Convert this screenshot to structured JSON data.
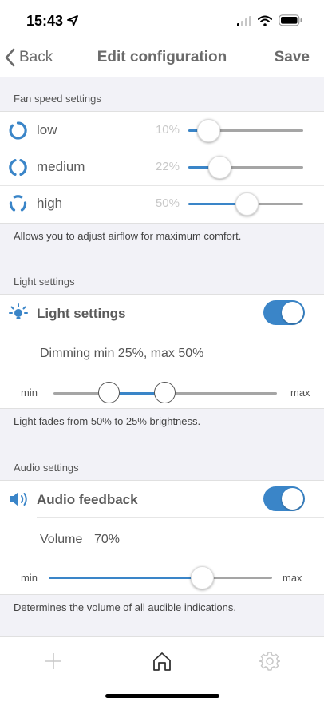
{
  "status_bar": {
    "time": "15:43"
  },
  "nav": {
    "back_label": "Back",
    "title": "Edit configuration",
    "save_label": "Save"
  },
  "fan": {
    "header": "Fan speed settings",
    "rows": [
      {
        "label": "low",
        "value": "10%",
        "level": 0.1
      },
      {
        "label": "medium",
        "value": "22%",
        "level": 0.22
      },
      {
        "label": "high",
        "value": "50%",
        "level": 0.5
      }
    ],
    "footnote": "Allows you to adjust airflow for maximum comfort."
  },
  "light": {
    "header": "Light settings",
    "toggle_label": "Light settings",
    "enabled": true,
    "dimming_text": "Dimming min 25%, max 50%",
    "range": {
      "min": 0.25,
      "max": 0.5
    },
    "min_label": "min",
    "max_label": "max",
    "footnote": "Light fades from 50% to 25% brightness."
  },
  "audio": {
    "header": "Audio settings",
    "toggle_label": "Audio feedback",
    "enabled": true,
    "volume_label": "Volume",
    "volume_value": "70%",
    "level": 0.7,
    "min_label": "min",
    "max_label": "max",
    "footnote": "Determines the volume of all audible indications."
  },
  "tabbar": {
    "icons": [
      "plus-icon",
      "home-icon",
      "gear-icon"
    ]
  },
  "colors": {
    "accent": "#3a85c8",
    "text": "#5a5a5a",
    "muted": "#c8c8c8",
    "background": "#f2f2f7"
  }
}
